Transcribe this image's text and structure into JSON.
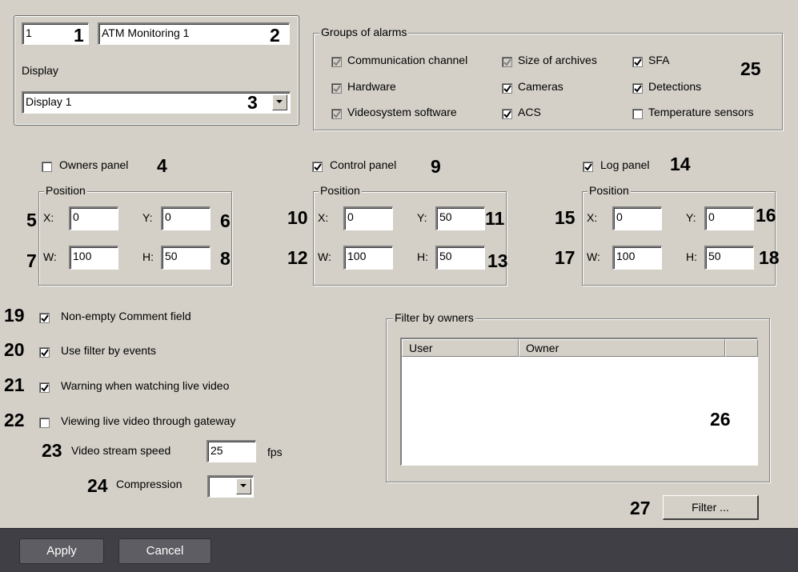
{
  "header_fields": {
    "id_value": "1",
    "name_value": "ATM Monitoring 1",
    "display_label": "Display",
    "display_value": "Display 1"
  },
  "groups_of_alarms": {
    "title": "Groups of alarms",
    "items": [
      {
        "label": "Communication channel",
        "checked": true,
        "enabled": false
      },
      {
        "label": "Size of archives",
        "checked": true,
        "enabled": false
      },
      {
        "label": "SFA",
        "checked": true,
        "enabled": true
      },
      {
        "label": "Hardware",
        "checked": true,
        "enabled": false
      },
      {
        "label": "Cameras",
        "checked": true,
        "enabled": true
      },
      {
        "label": "Detections",
        "checked": true,
        "enabled": true
      },
      {
        "label": "Videosystem software",
        "checked": true,
        "enabled": false
      },
      {
        "label": "ACS",
        "checked": true,
        "enabled": true
      },
      {
        "label": "Temperature sensors",
        "checked": false,
        "enabled": true
      }
    ]
  },
  "panels": [
    {
      "label": "Owners panel",
      "checked": false,
      "position_title": "Position",
      "x": "0",
      "y": "0",
      "w": "100",
      "h": "50"
    },
    {
      "label": "Control panel",
      "checked": true,
      "position_title": "Position",
      "x": "0",
      "y": "50",
      "w": "100",
      "h": "50"
    },
    {
      "label": "Log panel",
      "checked": true,
      "position_title": "Position",
      "x": "0",
      "y": "0",
      "w": "100",
      "h": "50"
    }
  ],
  "coord_labels": {
    "x": "X:",
    "y": "Y:",
    "w": "W:",
    "h": "H:"
  },
  "options": [
    {
      "label": "Non-empty Comment field",
      "checked": true
    },
    {
      "label": "Use filter by events",
      "checked": true
    },
    {
      "label": "Warning when watching live video",
      "checked": true
    },
    {
      "label": "Viewing live video through gateway",
      "checked": false
    }
  ],
  "video_stream": {
    "label": "Video stream speed",
    "value": "25",
    "unit": "fps"
  },
  "compression": {
    "label": "Compression",
    "value": ""
  },
  "filter_by_owners": {
    "title": "Filter by owners",
    "columns": [
      "User",
      "Owner"
    ],
    "rows": []
  },
  "filter_button_label": "Filter ...",
  "footer": {
    "apply_label": "Apply",
    "cancel_label": "Cancel"
  },
  "callouts": {
    "n1": "1",
    "n2": "2",
    "n3": "3",
    "n4": "4",
    "n5": "5",
    "n6": "6",
    "n7": "7",
    "n8": "8",
    "n9": "9",
    "n10": "10",
    "n11": "11",
    "n12": "12",
    "n13": "13",
    "n14": "14",
    "n15": "15",
    "n16": "16",
    "n17": "17",
    "n18": "18",
    "n19": "19",
    "n20": "20",
    "n21": "21",
    "n22": "22",
    "n23": "23",
    "n24": "24",
    "n25": "25",
    "n26": "26",
    "n27": "27"
  },
  "colors": {
    "panel_bg": "#d4d0c8",
    "bottom_bar": "#3f3f45",
    "dark_button": "#5d5d63"
  }
}
